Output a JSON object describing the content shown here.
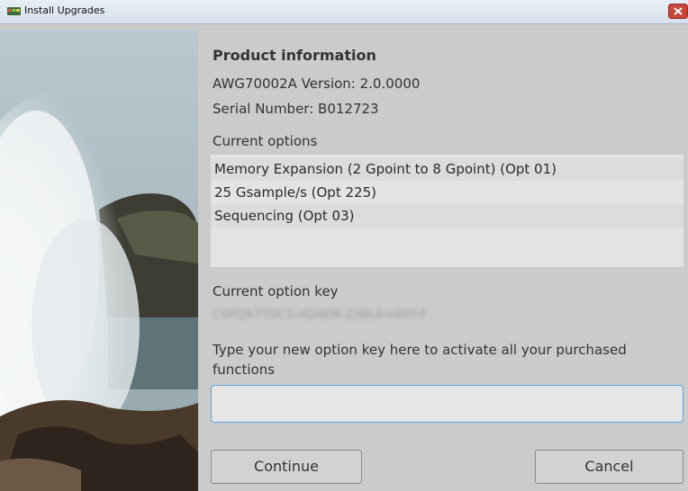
{
  "window": {
    "title": "Install Upgrades"
  },
  "product": {
    "heading": "Product information",
    "model_version": "AWG70002A   Version: 2.0.0000",
    "serial": "Serial Number: B012723"
  },
  "options": {
    "label": "Current options",
    "items": [
      "Memory Expansion (2 Gpoint to 8 Gpoint) (Opt 01)",
      "25 Gsample/s (Opt 225)",
      "Sequencing (Opt 03)"
    ]
  },
  "option_key": {
    "label": "Current option key",
    "value": "CSPQ9-TTDC5-HDAEM-Z3BL9-V4NY-F"
  },
  "new_key": {
    "instruction_line1": "Type your new option key here to activate all your purchased",
    "instruction_line2": "functions",
    "value": ""
  },
  "buttons": {
    "continue": "Continue",
    "cancel": "Cancel"
  },
  "colors": {
    "background": "#cbcbcb",
    "input_focus_border": "#5fa4d9",
    "close_red": "#c9463d"
  }
}
